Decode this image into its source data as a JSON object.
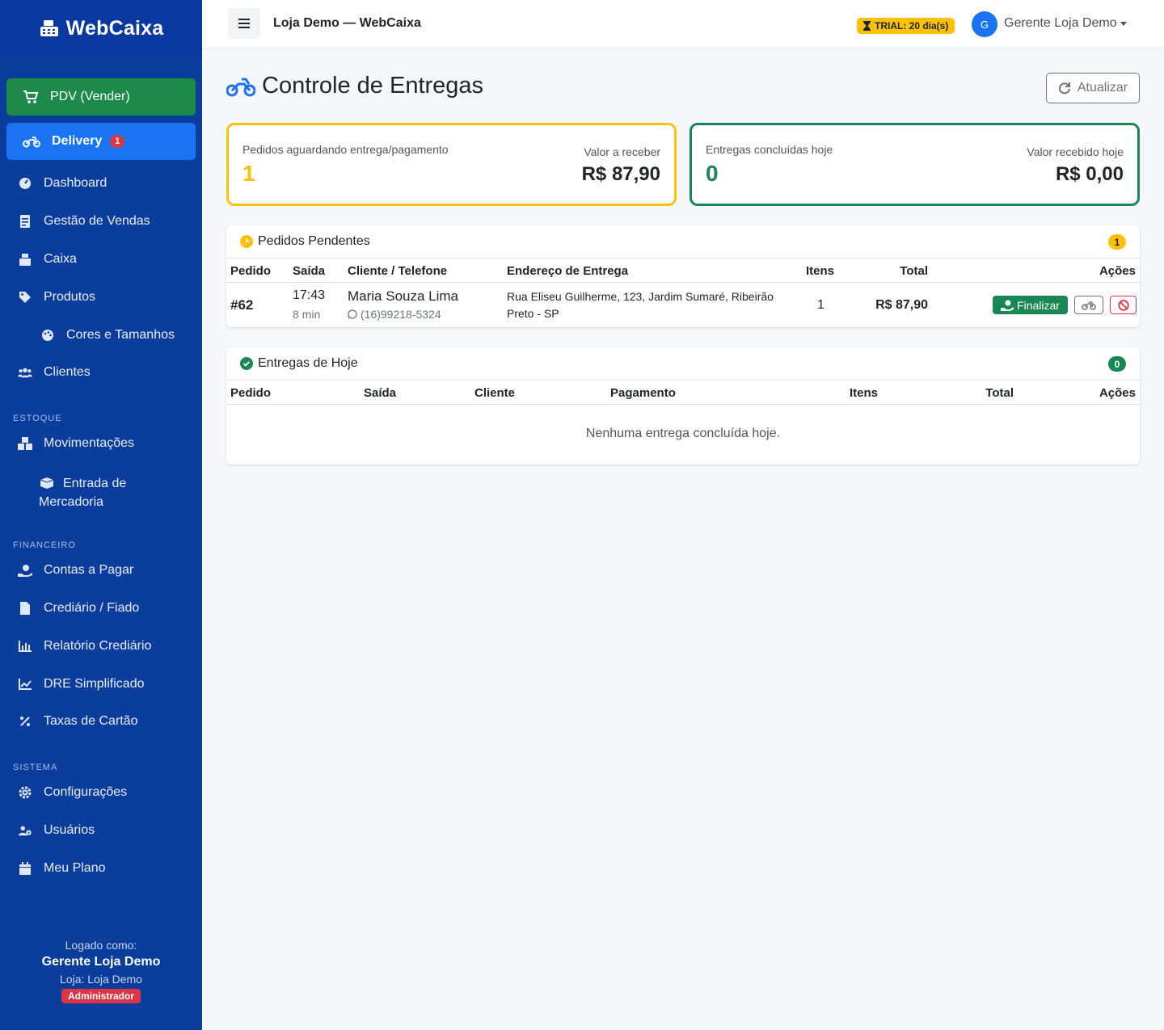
{
  "brand": {
    "name": "WebCaixa",
    "icon": "cash-register-icon"
  },
  "sidebar": {
    "pdv_label": "PDV (Vender)",
    "delivery_label": "Delivery",
    "delivery_badge": "1",
    "items": [
      {
        "label": "Dashboard",
        "icon": "gauge-icon"
      },
      {
        "label": "Gestão de Vendas",
        "icon": "receipt-icon"
      },
      {
        "label": "Caixa",
        "icon": "cash-register-icon"
      },
      {
        "label": "Produtos",
        "icon": "tag-icon"
      },
      {
        "label": "Cores e Tamanhos",
        "icon": "palette-icon"
      },
      {
        "label": "Clientes",
        "icon": "users-icon"
      }
    ],
    "section_estoque": "ESTOQUE",
    "estoque_items": [
      {
        "label": "Movimentações",
        "icon": "boxes-icon"
      },
      {
        "label": "Entrada de",
        "label2": "Mercadoria",
        "icon": "box-open-icon"
      }
    ],
    "section_financeiro": "FINANCEIRO",
    "financeiro_items": [
      {
        "label": "Contas a Pagar",
        "icon": "hand-holding-dollar-icon"
      },
      {
        "label": "Crediário / Fiado",
        "icon": "invoice-icon"
      },
      {
        "label": "Relatório Crediário",
        "icon": "bar-chart-icon"
      },
      {
        "label": "DRE Simplificado",
        "icon": "line-chart-icon"
      },
      {
        "label": "Taxas de Cartão",
        "icon": "percent-icon"
      }
    ],
    "section_sistema": "SISTEMA",
    "sistema_items": [
      {
        "label": "Configurações",
        "icon": "gear-icon"
      },
      {
        "label": "Usuários",
        "icon": "users-cog-icon"
      },
      {
        "label": "Meu Plano",
        "icon": "calendar-icon"
      }
    ],
    "footer": {
      "logged_as": "Logado como:",
      "user": "Gerente Loja Demo",
      "store": "Loja: Loja Demo",
      "role": "Administrador"
    }
  },
  "topbar": {
    "title": "Loja Demo — WebCaixa",
    "trial": "TRIAL: 20 dia(s)",
    "avatar_initial": "G",
    "user_name": "Gerente Loja Demo"
  },
  "page": {
    "title": "Controle de Entregas",
    "refresh_label": "Atualizar"
  },
  "stats": {
    "pending": {
      "label": "Pedidos aguardando entrega/pagamento",
      "count": "1",
      "value_label": "Valor a receber",
      "value": "R$ 87,90"
    },
    "done": {
      "label": "Entregas concluídas hoje",
      "count": "0",
      "value_label": "Valor recebido hoje",
      "value": "R$ 0,00"
    }
  },
  "pending_table": {
    "title": "Pedidos Pendentes",
    "count": "1",
    "headers": {
      "pedido": "Pedido",
      "saida": "Saída",
      "cliente": "Cliente / Telefone",
      "endereco": "Endereço de Entrega",
      "itens": "Itens",
      "total": "Total",
      "acoes": "Ações"
    },
    "rows": [
      {
        "pedido": "#62",
        "saida": "17:43",
        "saida_rel": "8 min",
        "cliente": "Maria Souza Lima",
        "telefone": "(16)99218-5324",
        "endereco_1": "Rua Eliseu Guilherme, 123, Jardim Sumaré, Ribeirão",
        "endereco_2": "Preto - SP",
        "itens": "1",
        "total": "R$ 87,90",
        "finalizar_label": "Finalizar"
      }
    ]
  },
  "today_table": {
    "title": "Entregas de Hoje",
    "count": "0",
    "headers": {
      "pedido": "Pedido",
      "saida": "Saída",
      "cliente": "Cliente",
      "pagamento": "Pagamento",
      "itens": "Itens",
      "total": "Total",
      "acoes": "Ações"
    },
    "empty": "Nenhuma entrega concluída hoje."
  },
  "colors": {
    "sidebar": "#0a3d9c",
    "primary": "#1a73f0",
    "success": "#198754",
    "warning": "#ffc107",
    "danger": "#dc3545"
  }
}
